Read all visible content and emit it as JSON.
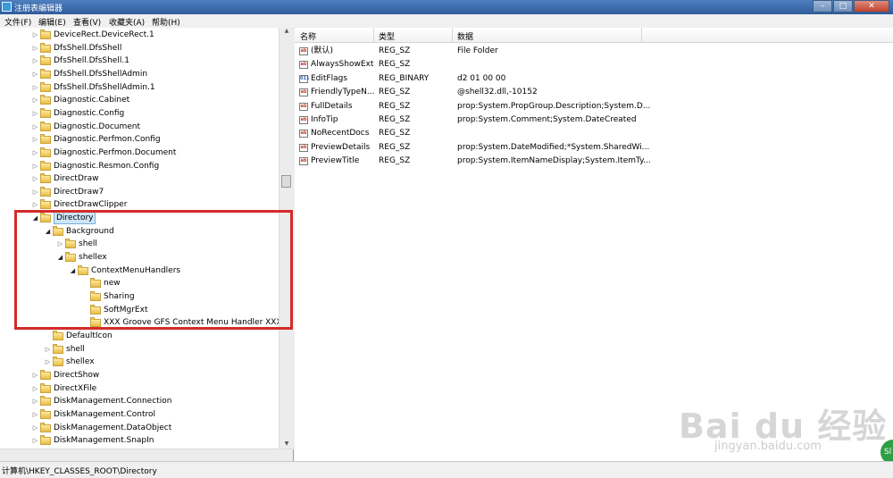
{
  "window": {
    "title": "注册表编辑器",
    "minimize": "–",
    "maximize": "□",
    "close": "✕"
  },
  "menu": [
    "文件(F)",
    "编辑(E)",
    "查看(V)",
    "收藏夹(A)",
    "帮助(H)"
  ],
  "tree": [
    {
      "label": "DeviceRect.DeviceRect.1",
      "level": 0,
      "toggle": "collapsed"
    },
    {
      "label": "DfsShell.DfsShell",
      "level": 0,
      "toggle": "collapsed"
    },
    {
      "label": "DfsShell.DfsShell.1",
      "level": 0,
      "toggle": "collapsed"
    },
    {
      "label": "DfsShell.DfsShellAdmin",
      "level": 0,
      "toggle": "collapsed"
    },
    {
      "label": "DfsShell.DfsShellAdmin.1",
      "level": 0,
      "toggle": "collapsed"
    },
    {
      "label": "Diagnostic.Cabinet",
      "level": 0,
      "toggle": "collapsed"
    },
    {
      "label": "Diagnostic.Config",
      "level": 0,
      "toggle": "collapsed"
    },
    {
      "label": "Diagnostic.Document",
      "level": 0,
      "toggle": "collapsed"
    },
    {
      "label": "Diagnostic.Perfmon.Config",
      "level": 0,
      "toggle": "collapsed"
    },
    {
      "label": "Diagnostic.Perfmon.Document",
      "level": 0,
      "toggle": "collapsed"
    },
    {
      "label": "Diagnostic.Resmon.Config",
      "level": 0,
      "toggle": "collapsed"
    },
    {
      "label": "DirectDraw",
      "level": 0,
      "toggle": "collapsed"
    },
    {
      "label": "DirectDraw7",
      "level": 0,
      "toggle": "collapsed"
    },
    {
      "label": "DirectDrawClipper",
      "level": 0,
      "toggle": "collapsed"
    },
    {
      "label": "Directory",
      "level": 0,
      "toggle": "expanded",
      "selected": true
    },
    {
      "label": "Background",
      "level": 1,
      "toggle": "expanded"
    },
    {
      "label": "shell",
      "level": 2,
      "toggle": "collapsed"
    },
    {
      "label": "shellex",
      "level": 2,
      "toggle": "expanded"
    },
    {
      "label": "ContextMenuHandlers",
      "level": 3,
      "toggle": "expanded"
    },
    {
      "label": "new",
      "level": 4,
      "toggle": "none"
    },
    {
      "label": "Sharing",
      "level": 4,
      "toggle": "none"
    },
    {
      "label": "SoftMgrExt",
      "level": 4,
      "toggle": "none"
    },
    {
      "label": "XXX Groove GFS Context Menu Handler XXX",
      "level": 4,
      "toggle": "none"
    },
    {
      "label": "DefaultIcon",
      "level": 1,
      "toggle": "none"
    },
    {
      "label": "shell",
      "level": 1,
      "toggle": "collapsed"
    },
    {
      "label": "shellex",
      "level": 1,
      "toggle": "collapsed"
    },
    {
      "label": "DirectShow",
      "level": 0,
      "toggle": "collapsed"
    },
    {
      "label": "DirectXFile",
      "level": 0,
      "toggle": "collapsed"
    },
    {
      "label": "DiskManagement.Connection",
      "level": 0,
      "toggle": "collapsed"
    },
    {
      "label": "DiskManagement.Control",
      "level": 0,
      "toggle": "collapsed"
    },
    {
      "label": "DiskManagement.DataObject",
      "level": 0,
      "toggle": "collapsed"
    },
    {
      "label": "DiskManagement.SnapIn",
      "level": 0,
      "toggle": "collapsed"
    }
  ],
  "columns": {
    "name": "名称",
    "type": "类型",
    "data": "数据"
  },
  "values": [
    {
      "icon": "string-value-icon",
      "badge": "ab",
      "name": "(默认)",
      "type": "REG_SZ",
      "data": "File Folder"
    },
    {
      "icon": "string-value-icon",
      "badge": "ab",
      "name": "AlwaysShowExt",
      "type": "REG_SZ",
      "data": ""
    },
    {
      "icon": "binary-value-icon",
      "badge": "011",
      "name": "EditFlags",
      "type": "REG_BINARY",
      "data": "d2 01 00 00"
    },
    {
      "icon": "string-value-icon",
      "badge": "ab",
      "name": "FriendlyTypeN...",
      "type": "REG_SZ",
      "data": "@shell32.dll,-10152"
    },
    {
      "icon": "string-value-icon",
      "badge": "ab",
      "name": "FullDetails",
      "type": "REG_SZ",
      "data": "prop:System.PropGroup.Description;System.D..."
    },
    {
      "icon": "string-value-icon",
      "badge": "ab",
      "name": "InfoTip",
      "type": "REG_SZ",
      "data": "prop:System.Comment;System.DateCreated"
    },
    {
      "icon": "string-value-icon",
      "badge": "ab",
      "name": "NoRecentDocs",
      "type": "REG_SZ",
      "data": ""
    },
    {
      "icon": "string-value-icon",
      "badge": "ab",
      "name": "PreviewDetails",
      "type": "REG_SZ",
      "data": "prop:System.DateModified;*System.SharedWi..."
    },
    {
      "icon": "string-value-icon",
      "badge": "ab",
      "name": "PreviewTitle",
      "type": "REG_SZ",
      "data": "prop:System.ItemNameDisplay;System.ItemTy..."
    }
  ],
  "status": "计算机\\HKEY_CLASSES_ROOT\\Directory",
  "watermark": {
    "logo": "Bai du 经验",
    "url": "jingyan.baidu.com"
  },
  "corner_badge": "Sl",
  "colors": {
    "highlight": "#d42a2a",
    "selection": "#cde6f7"
  }
}
